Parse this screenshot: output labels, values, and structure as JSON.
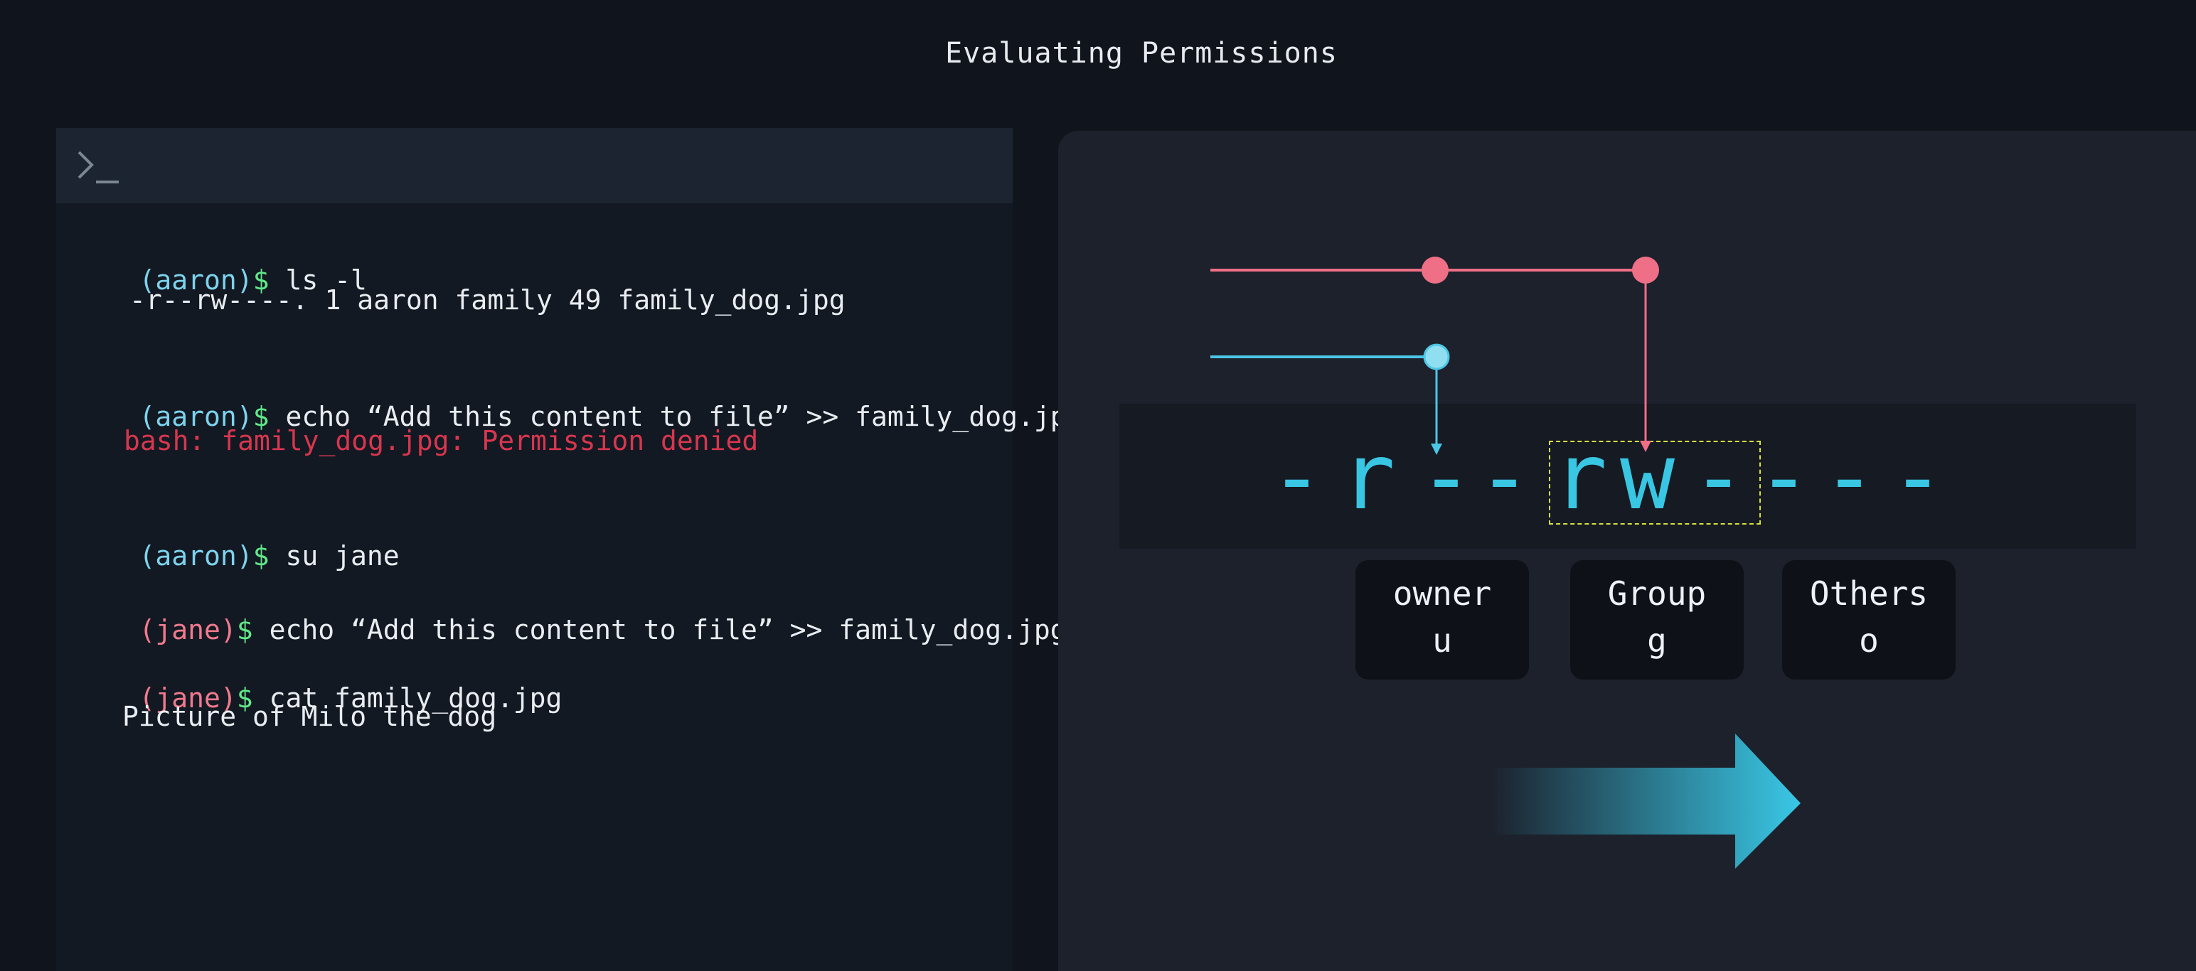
{
  "page": {
    "title": "Evaluating Permissions"
  },
  "terminal": {
    "prompt_icon": "terminal-prompt-icon",
    "lines": [
      {
        "user": "(aaron)",
        "dollar": "$",
        "cmd": " ls -l"
      },
      {
        "output": "-r--rw----. 1 aaron family 49 family_dog.jpg"
      },
      {
        "user": "(aaron)",
        "dollar": "$",
        "cmd": " echo “Add this content to file” >> family_dog.jpg"
      },
      {
        "output": "bash: family_dog.jpg: Permission denied"
      },
      {
        "user": "(aaron)",
        "dollar": "$",
        "cmd": " su jane"
      },
      {
        "user": "(jane)",
        "dollar": "$",
        "cmd": " echo “Add this content to file” >> family_dog.jpg"
      },
      {
        "user": "(jane)",
        "dollar": "$",
        "cmd": " cat family_dog.jpg"
      },
      {
        "output": "Picture of Milo the dog"
      }
    ]
  },
  "diagram": {
    "permission_chars": [
      "-",
      "r",
      "-",
      "-",
      "r",
      "w",
      "-",
      "-",
      "-",
      "-"
    ],
    "classes": [
      {
        "name": "owner",
        "abbr": "u"
      },
      {
        "name": "Group",
        "abbr": "g"
      },
      {
        "name": "Others",
        "abbr": "o"
      }
    ],
    "colors": {
      "user_line": "#4cc6e6",
      "group_line": "#ee6f86",
      "permission_text": "#38c6e3",
      "highlight": "#d8e03a",
      "arrow": "#39c8e6"
    },
    "arrow_icon": "arrow-right-icon"
  }
}
